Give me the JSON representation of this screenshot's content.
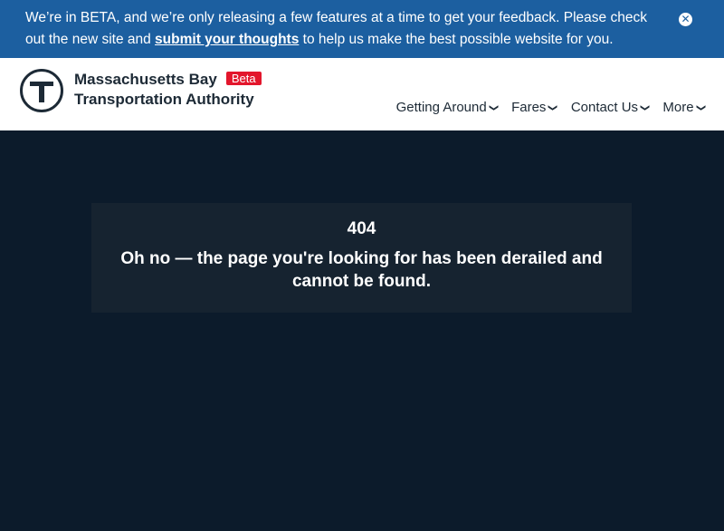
{
  "banner": {
    "text_before": "We’re in BETA, and we’re only releasing a few features at a time to get your feedback. Please check out the new site and ",
    "link_text": "submit your thoughts",
    "text_after": " to help us make the best possible website for you.",
    "close_glyph": "✕"
  },
  "header": {
    "name_line1": "Massachusetts Bay",
    "name_line2": "Transportation Authority",
    "beta_badge": "Beta",
    "nav": [
      {
        "label": "Getting Around"
      },
      {
        "label": "Fares"
      },
      {
        "label": "Contact Us"
      },
      {
        "label": "More"
      }
    ]
  },
  "error": {
    "code": "404",
    "message": "Oh no — the page you're looking for has been derailed and cannot be found."
  },
  "colors": {
    "banner_bg": "#1c5fa0",
    "page_bg": "#0c1b2b",
    "panel_bg": "#162330",
    "beta_red": "#e3162c",
    "text_dark": "#1d2a36"
  }
}
